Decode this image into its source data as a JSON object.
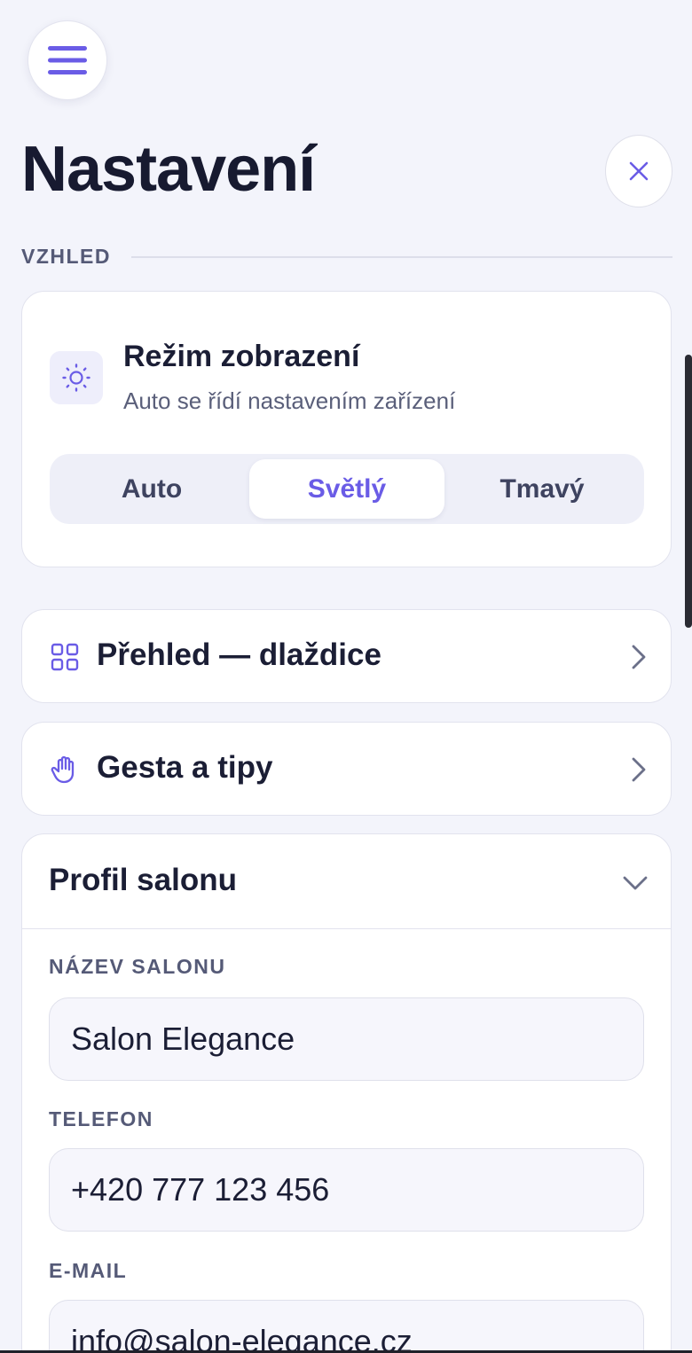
{
  "header": {
    "title": "Nastavení",
    "menu_icon": "hamburger-icon",
    "close_icon": "close-icon"
  },
  "appearance": {
    "section_label": "VZHLED",
    "mode": {
      "icon": "sun-icon",
      "title": "Režim zobrazení",
      "subtitle": "Auto se řídí nastavením zařízení",
      "options": [
        "Auto",
        "Světlý",
        "Tmavý"
      ],
      "selected": "Světlý"
    }
  },
  "nav": {
    "tiles": {
      "icon": "grid-icon",
      "label": "Přehled — dlaždice"
    },
    "gestures": {
      "icon": "hand-icon",
      "label": "Gesta a tipy"
    }
  },
  "profile": {
    "title": "Profil salonu",
    "fields": [
      {
        "label": "NÁZEV SALONU",
        "value": "Salon Elegance"
      },
      {
        "label": "TELEFON",
        "value": "+420 777 123 456"
      },
      {
        "label": "E-MAIL",
        "value": "info@salon-elegance.cz"
      }
    ]
  },
  "colors": {
    "accent": "#6a5ce6",
    "background": "#f3f4fb",
    "text": "#1b1e35",
    "muted": "#555a77"
  }
}
